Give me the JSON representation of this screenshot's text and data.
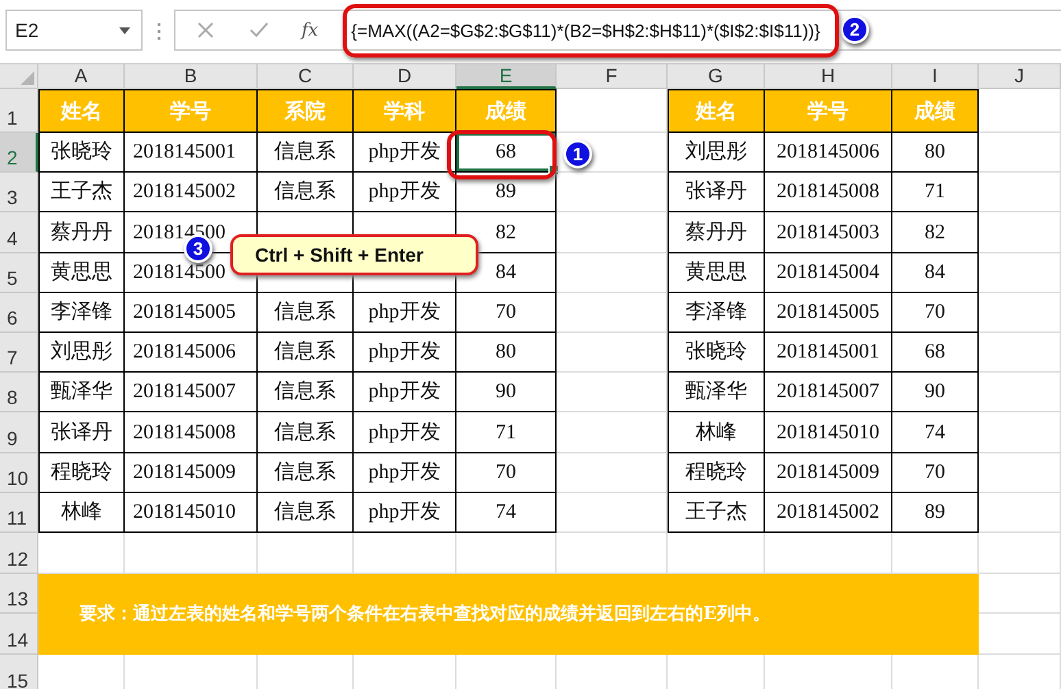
{
  "formula_bar": {
    "name_box": "E2",
    "function_label": "fx",
    "formula": "{=MAX((A2=$G$2:$G$11)*(B2=$H$2:$H$11)*($I$2:$I$11))}"
  },
  "columns": [
    {
      "label": "A",
      "selected": false
    },
    {
      "label": "B",
      "selected": false
    },
    {
      "label": "C",
      "selected": false
    },
    {
      "label": "D",
      "selected": false
    },
    {
      "label": "E",
      "selected": true
    },
    {
      "label": "F",
      "selected": false
    },
    {
      "label": "G",
      "selected": false
    },
    {
      "label": "H",
      "selected": false
    },
    {
      "label": "I",
      "selected": false
    },
    {
      "label": "J",
      "selected": false
    }
  ],
  "rows": [
    {
      "label": "1",
      "selected": false
    },
    {
      "label": "2",
      "selected": true
    },
    {
      "label": "3",
      "selected": false
    },
    {
      "label": "4",
      "selected": false
    },
    {
      "label": "5",
      "selected": false
    },
    {
      "label": "6",
      "selected": false
    },
    {
      "label": "7",
      "selected": false
    },
    {
      "label": "8",
      "selected": false
    },
    {
      "label": "9",
      "selected": false
    },
    {
      "label": "10",
      "selected": false
    },
    {
      "label": "11",
      "selected": false
    },
    {
      "label": "12",
      "selected": false
    },
    {
      "label": "13",
      "selected": false
    },
    {
      "label": "14",
      "selected": false
    },
    {
      "label": "15",
      "selected": false
    }
  ],
  "left_table": {
    "headers": [
      "姓名",
      "学号",
      "系院",
      "学科",
      "成绩"
    ],
    "rows": [
      [
        "张晓玲",
        "2018145001",
        "信息系",
        "php开发",
        "68"
      ],
      [
        "王子杰",
        "2018145002",
        "信息系",
        "php开发",
        "89"
      ],
      [
        "蔡丹丹",
        "201814500",
        null,
        null,
        "82"
      ],
      [
        "黄思思",
        "201814500",
        null,
        null,
        "84"
      ],
      [
        "李泽锋",
        "2018145005",
        "信息系",
        "php开发",
        "70"
      ],
      [
        "刘思彤",
        "2018145006",
        "信息系",
        "php开发",
        "80"
      ],
      [
        "甄泽华",
        "2018145007",
        "信息系",
        "php开发",
        "90"
      ],
      [
        "张译丹",
        "2018145008",
        "信息系",
        "php开发",
        "71"
      ],
      [
        "程晓玲",
        "2018145009",
        "信息系",
        "php开发",
        "70"
      ],
      [
        "林峰",
        "2018145010",
        "信息系",
        "php开发",
        "74"
      ]
    ]
  },
  "right_table": {
    "headers": [
      "姓名",
      "学号",
      "成绩"
    ],
    "rows": [
      [
        "刘思彤",
        "2018145006",
        "80"
      ],
      [
        "张译丹",
        "2018145008",
        "71"
      ],
      [
        "蔡丹丹",
        "2018145003",
        "82"
      ],
      [
        "黄思思",
        "2018145004",
        "84"
      ],
      [
        "李泽锋",
        "2018145005",
        "70"
      ],
      [
        "张晓玲",
        "2018145001",
        "68"
      ],
      [
        "甄泽华",
        "2018145007",
        "90"
      ],
      [
        "林峰",
        "2018145010",
        "74"
      ],
      [
        "程晓玲",
        "2018145009",
        "70"
      ],
      [
        "王子杰",
        "2018145002",
        "89"
      ]
    ]
  },
  "note": "要求：通过左表的姓名和学号两个条件在右表中查找对应的成绩并返回到左右的E列中。",
  "callouts": [
    {
      "number": "1"
    },
    {
      "number": "2"
    },
    {
      "number": "3",
      "text": "Ctrl + Shift + Enter"
    }
  ]
}
